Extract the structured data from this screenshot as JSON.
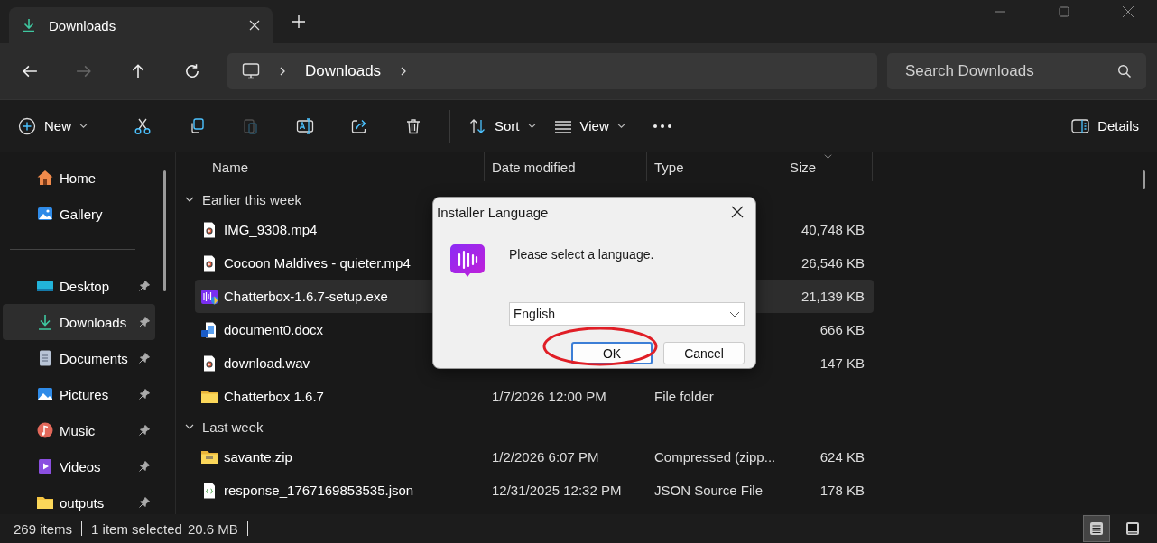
{
  "tabs": [
    {
      "label": "Downloads",
      "selected": true
    }
  ],
  "address": {
    "crumbs": [
      "Downloads"
    ]
  },
  "search": {
    "placeholder": "Search Downloads"
  },
  "toolbar": {
    "new_label": "New",
    "sort_label": "Sort",
    "view_label": "View",
    "details_label": "Details",
    "paste_disabled": true
  },
  "sidebar": {
    "sections": [
      {
        "items": [
          {
            "label": "Home",
            "kind": "home",
            "pinned": false,
            "selected": false
          },
          {
            "label": "Gallery",
            "kind": "gallery",
            "pinned": false,
            "selected": false
          }
        ]
      },
      {
        "items": [
          {
            "label": "Desktop",
            "kind": "desktop",
            "pinned": true,
            "selected": false
          },
          {
            "label": "Downloads",
            "kind": "downloads",
            "pinned": true,
            "selected": true
          },
          {
            "label": "Documents",
            "kind": "documents",
            "pinned": true,
            "selected": false
          },
          {
            "label": "Pictures",
            "kind": "pictures",
            "pinned": true,
            "selected": false
          },
          {
            "label": "Music",
            "kind": "music",
            "pinned": true,
            "selected": false
          },
          {
            "label": "Videos",
            "kind": "videos",
            "pinned": true,
            "selected": false
          },
          {
            "label": "outputs",
            "kind": "folder",
            "pinned": true,
            "selected": false
          }
        ]
      }
    ]
  },
  "table": {
    "columns": [
      "Name",
      "Date modified",
      "Type",
      "Size"
    ],
    "groups": [
      {
        "label": "Earlier this week",
        "expanded": true,
        "rows": [
          {
            "name": "IMG_9308.mp4",
            "kind": "video",
            "size": "40,748 KB",
            "selected": false
          },
          {
            "name": "Cocoon Maldives - quieter.mp4",
            "kind": "video",
            "size": "26,546 KB",
            "selected": false
          },
          {
            "name": "Chatterbox-1.6.7-setup.exe",
            "kind": "exe",
            "size": "21,139 KB",
            "selected": true
          },
          {
            "name": "document0.docx",
            "kind": "docx",
            "size": "666 KB",
            "selected": false
          },
          {
            "name": "download.wav",
            "kind": "video",
            "size": "147 KB",
            "selected": false
          },
          {
            "name": "Chatterbox 1.6.7",
            "kind": "folder",
            "date": "1/7/2026 12:00 PM",
            "type": "File folder",
            "selected": false
          }
        ]
      },
      {
        "label": "Last week",
        "expanded": true,
        "rows": [
          {
            "name": "savante.zip",
            "kind": "zip",
            "date": "1/2/2026 6:07 PM",
            "type": "Compressed (zipp...",
            "size": "624 KB",
            "selected": false
          },
          {
            "name": "response_1767169853535.json",
            "kind": "json",
            "date": "12/31/2025 12:32 PM",
            "type": "JSON Source File",
            "size": "178 KB",
            "selected": false
          }
        ]
      }
    ]
  },
  "dialog": {
    "title": "Installer Language",
    "message": "Please select a language.",
    "language": "English",
    "buttons": [
      {
        "label": "OK",
        "kind": "default",
        "highlighted": true
      },
      {
        "label": "Cancel",
        "kind": "normal",
        "highlighted": false
      }
    ]
  },
  "status_bar": {
    "item_count": "269 items",
    "selection": "1 item selected",
    "selection_size": "20.6 MB",
    "view_modes": [
      {
        "kind": "details",
        "selected": true
      },
      {
        "kind": "tiles",
        "selected": false
      }
    ]
  }
}
